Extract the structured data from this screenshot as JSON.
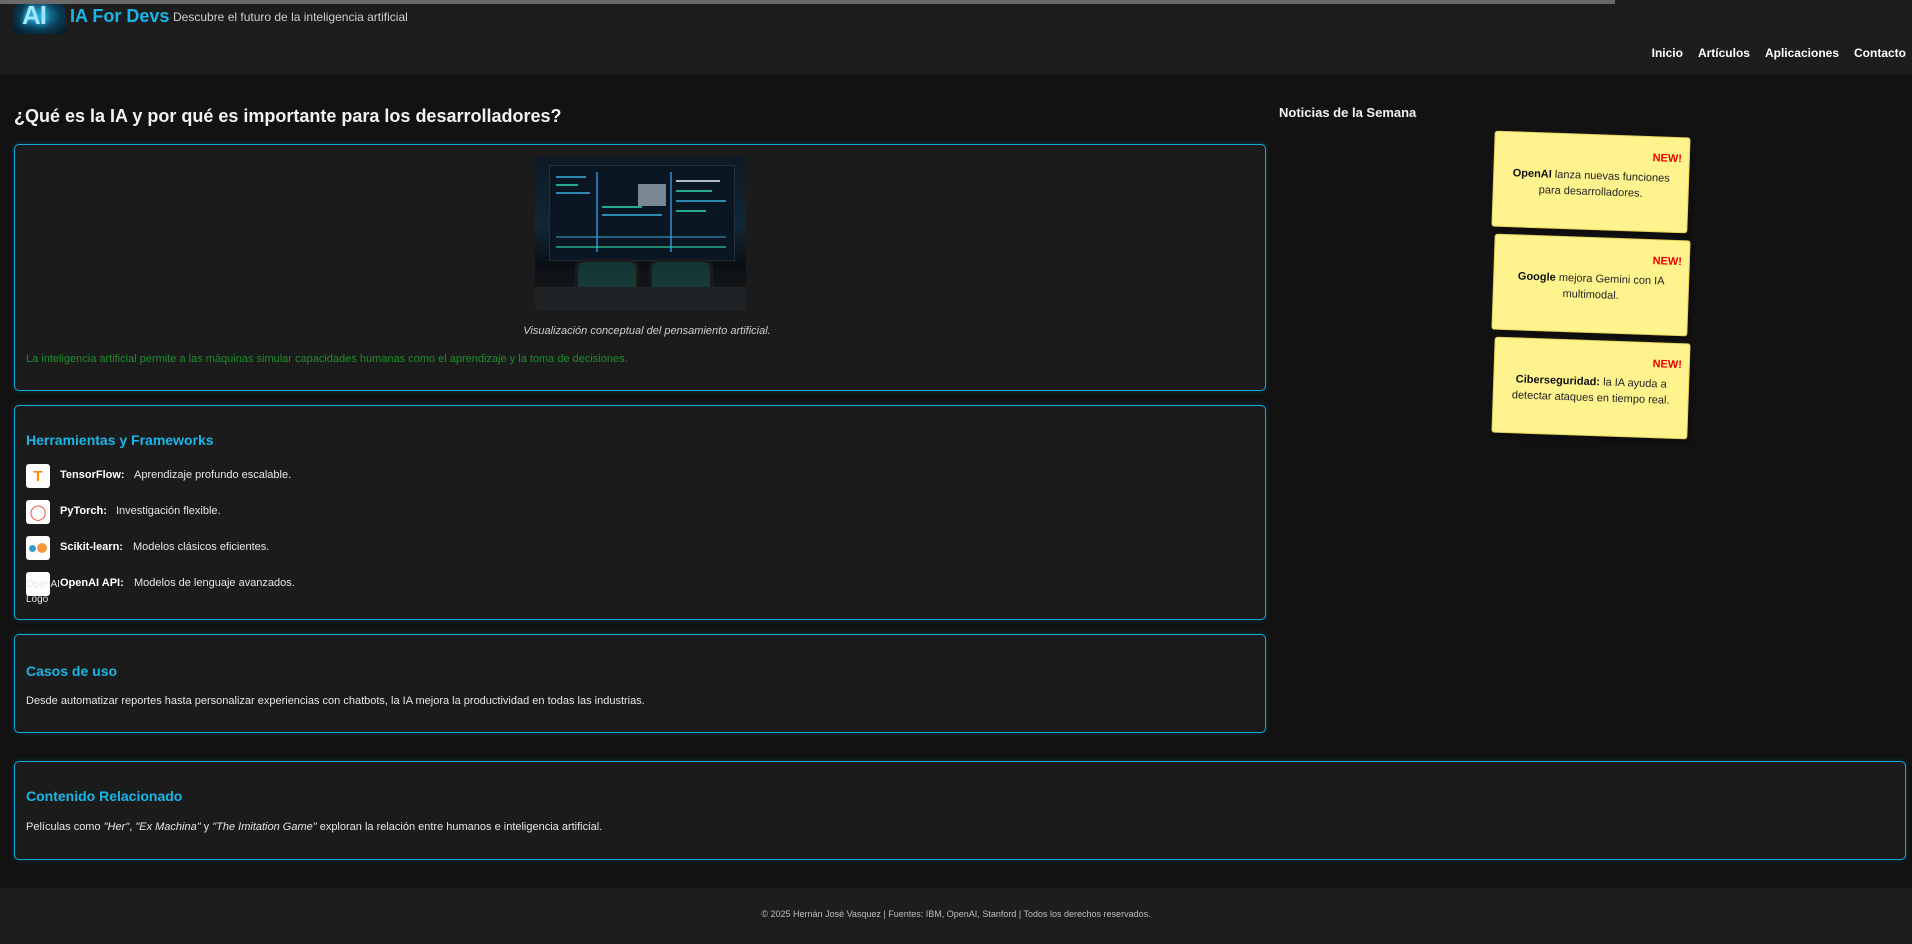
{
  "header": {
    "logo_text": "AI",
    "brand": "IA For Devs",
    "tagline": "Descubre el futuro de la inteligencia artificial",
    "nav": [
      "Inicio",
      "Artículos",
      "Aplicaciones",
      "Contacto"
    ]
  },
  "main": {
    "title": "¿Qué es la IA y por qué es importante para los desarrolladores?",
    "intro": {
      "caption": "Visualización conceptual del pensamiento artificial.",
      "text": "La inteligencia artificial permite a las máquinas simular capacidades humanas como el aprendizaje y la toma de decisiones."
    },
    "tools": {
      "title": "Herramientas y Frameworks",
      "items": [
        {
          "name": "TensorFlow:",
          "desc": "Aprendizaje profundo escalable.",
          "icon": "tensorflow-icon"
        },
        {
          "name": "PyTorch:",
          "desc": "Investigación flexible.",
          "icon": "pytorch-icon"
        },
        {
          "name": "Scikit-learn:",
          "desc": "Modelos clásicos eficientes.",
          "icon": "scikit-learn-icon"
        },
        {
          "name": "OpenAI API:",
          "desc": "Modelos de lenguaje avanzados.",
          "icon": "openai-icon"
        }
      ],
      "broken_logo_alt": "OpenAI Logo"
    },
    "use_cases": {
      "title": "Casos de uso",
      "text": "Desde automatizar reportes hasta personalizar experiencias con chatbots, la IA mejora la productividad en todas las industrias."
    },
    "related": {
      "title": "Contenido Relacionado",
      "text_pre": "Películas como ",
      "film1": "\"Her\"",
      "sep1": ", ",
      "film2": "\"Ex Machina\"",
      "sep2": " y ",
      "film3": "\"The Imitation Game\"",
      "text_post": " exploran la relación entre humanos e inteligencia artificial."
    }
  },
  "sidebar": {
    "title": "Noticias de la Semana",
    "notes": [
      {
        "badge": "NEW!",
        "bold": "OpenAI",
        "text": " lanza nuevas funciones para desarrolladores."
      },
      {
        "badge": "NEW!",
        "bold": "Google",
        "text": " mejora Gemini con IA multimodal."
      },
      {
        "badge": "NEW!",
        "bold": "Ciberseguridad:",
        "text": " la IA ayuda a detectar ataques en tiempo real."
      }
    ]
  },
  "footer": {
    "text": "© 2025 Hernán José Vasquez | Fuentes: IBM, OpenAI, Stanford | Todos los derechos reservados."
  },
  "colors": {
    "accent": "#19b6e8",
    "note_bg": "#fff38e",
    "badge": "#ee0000",
    "green_text": "#1c8f2b"
  }
}
